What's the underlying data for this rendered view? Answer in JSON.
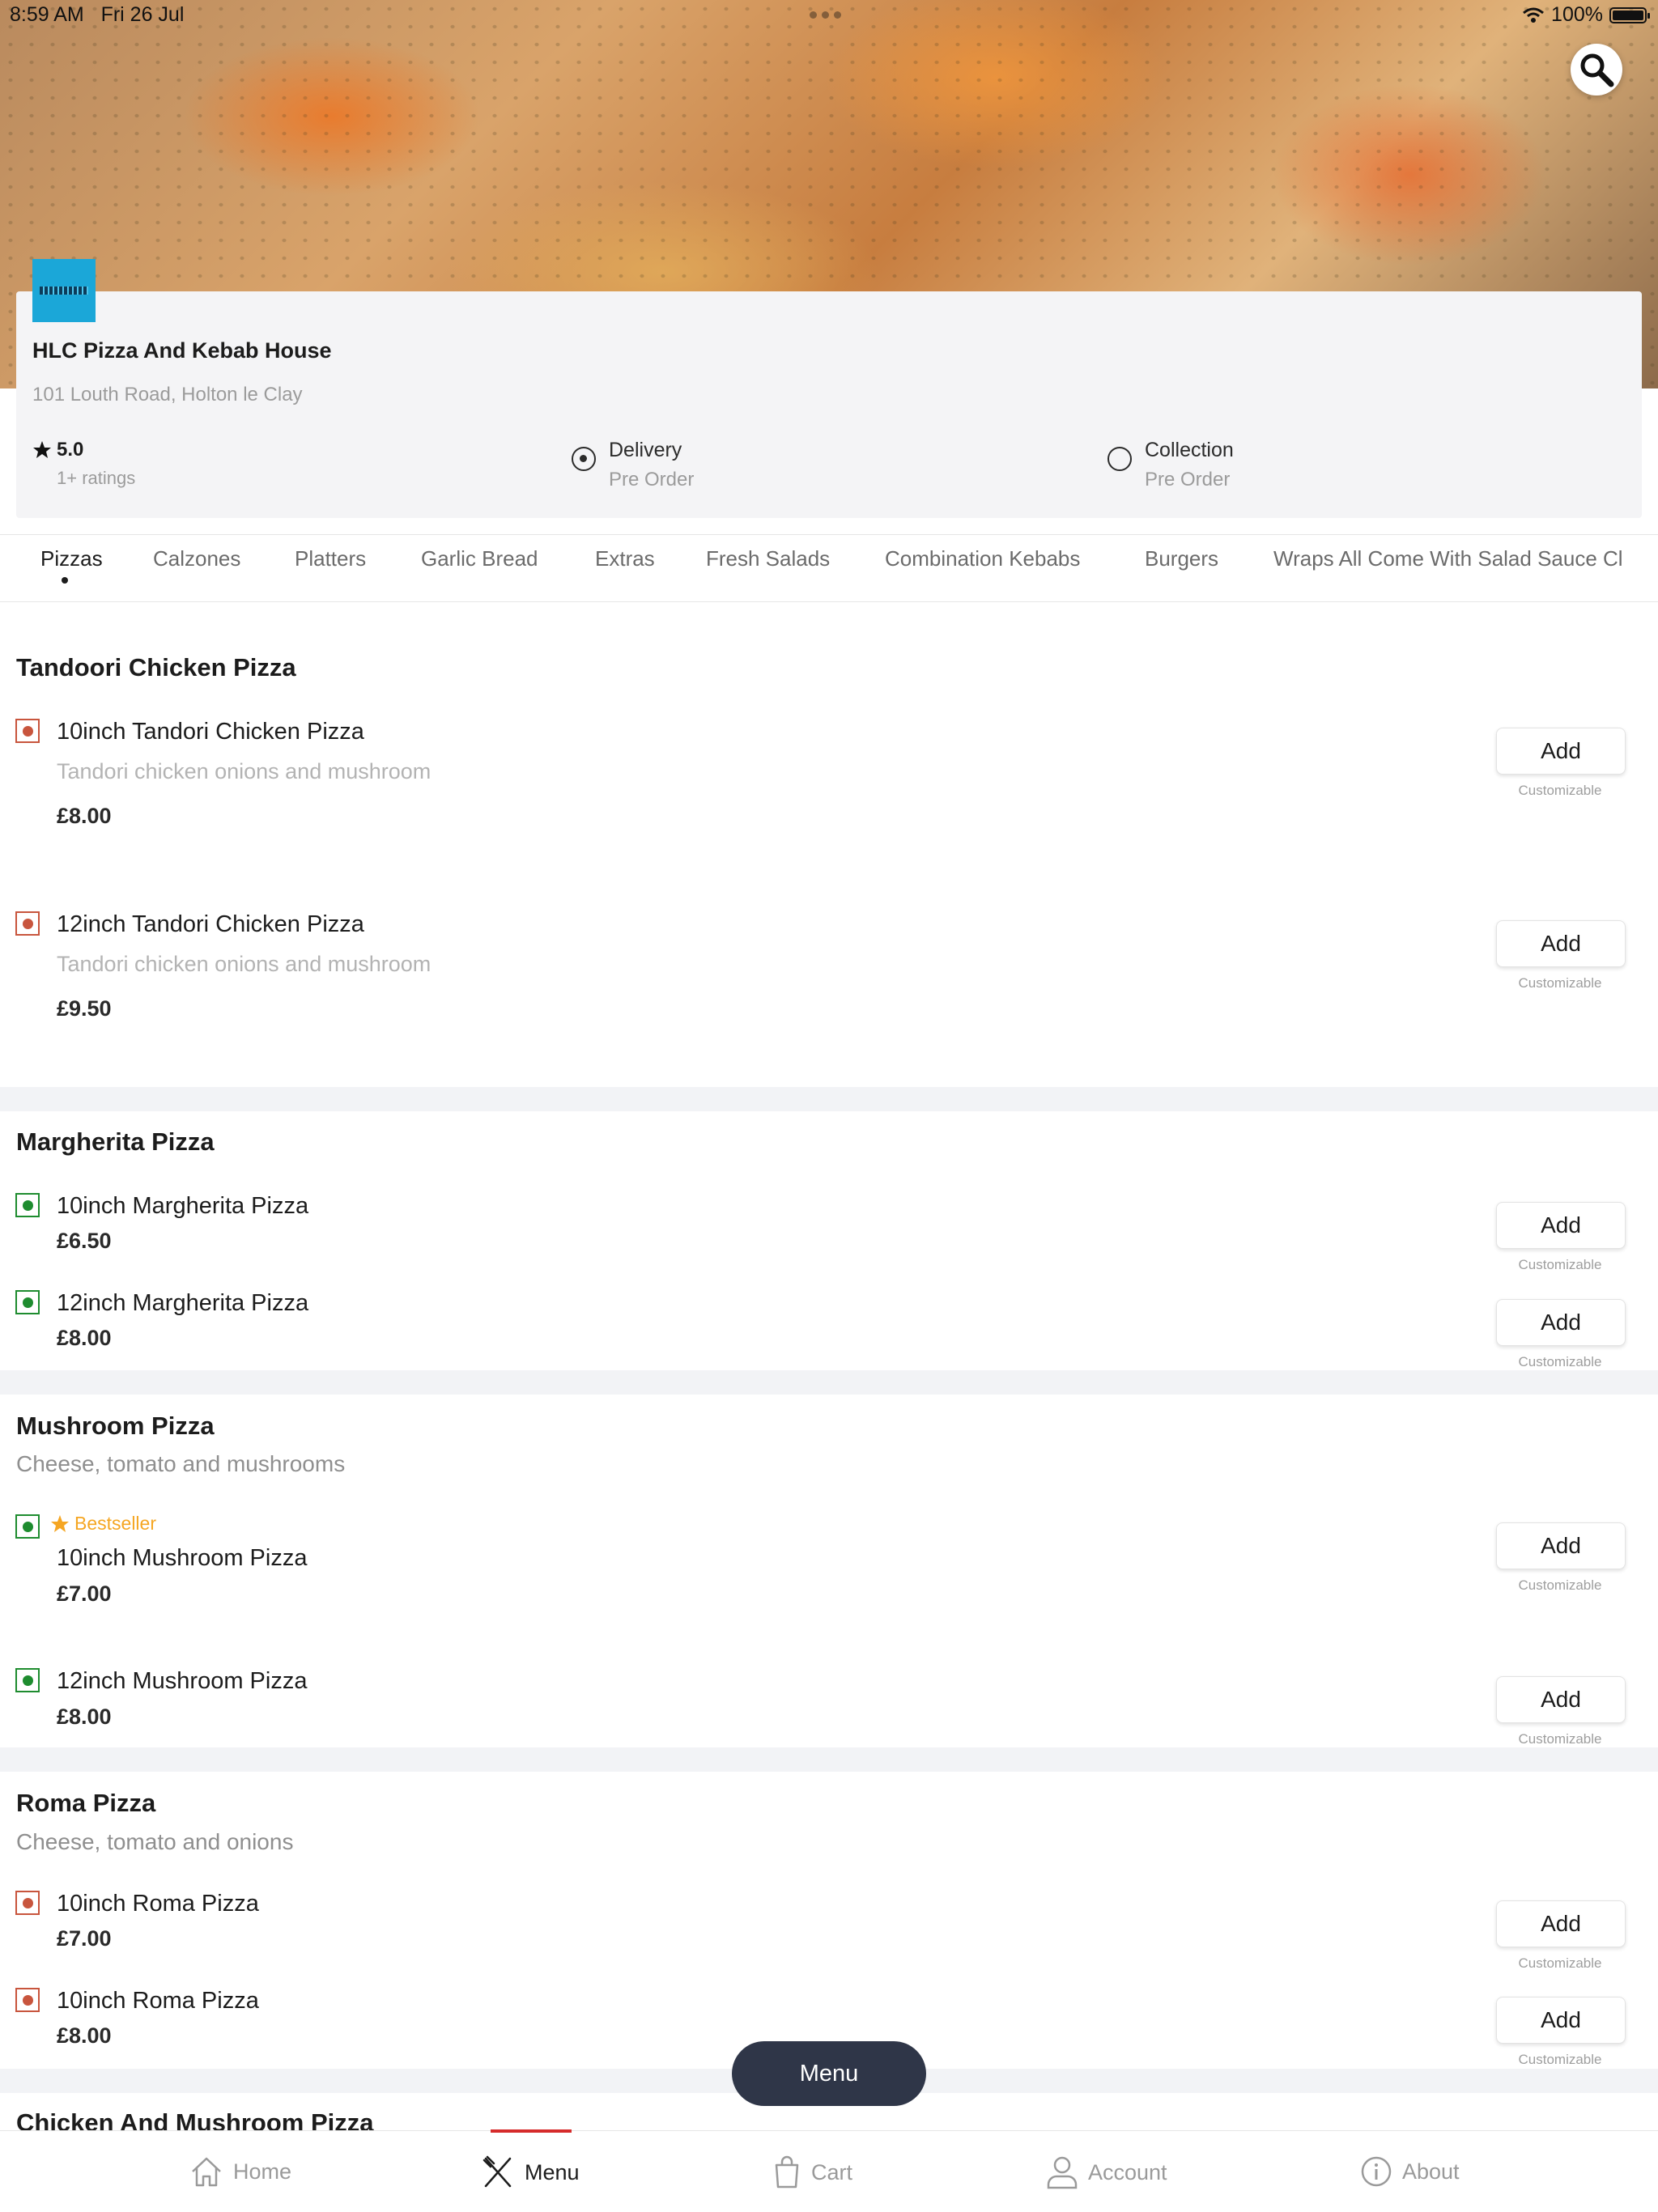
{
  "status_bar": {
    "time": "8:59 AM",
    "date": "Fri 26 Jul",
    "battery": "100%"
  },
  "icons": {
    "search": "search-icon",
    "star": "star-icon",
    "home": "home-icon",
    "menu": "fork-knife-icon",
    "cart": "cart-icon",
    "account": "account-icon",
    "about": "info-icon"
  },
  "restaurant": {
    "name": "HLC Pizza And Kebab House",
    "address": "101 Louth Road, Holton le Clay",
    "rating": "5.0",
    "ratings_count": "1+ ratings",
    "delivery": {
      "label": "Delivery",
      "sub": "Pre Order",
      "selected": true
    },
    "collection": {
      "label": "Collection",
      "sub": "Pre Order",
      "selected": false
    }
  },
  "tabs": [
    "Pizzas",
    "Calzones",
    "Platters",
    "Garlic Bread",
    "Extras",
    "Fresh Salads",
    "Combination Kebabs",
    "Burgers",
    "Wraps All Come With Salad Sauce Cl"
  ],
  "sections": [
    {
      "title": "Tandoori Chicken Pizza",
      "items": [
        {
          "name": "10inch Tandori Chicken Pizza",
          "desc": "Tandori chicken onions and mushroom",
          "price": "£8.00",
          "add": "Add",
          "custom": "Customizable"
        },
        {
          "name": "12inch Tandori Chicken Pizza",
          "desc": "Tandori chicken onions and mushroom",
          "price": "£9.50",
          "add": "Add",
          "custom": "Customizable"
        }
      ]
    },
    {
      "title": "Margherita Pizza",
      "items": [
        {
          "name": "10inch Margherita Pizza",
          "price": "£6.50",
          "add": "Add",
          "custom": "Customizable"
        },
        {
          "name": "12inch Margherita Pizza",
          "price": "£8.00",
          "add": "Add",
          "custom": "Customizable"
        }
      ]
    },
    {
      "title": "Mushroom Pizza",
      "desc": "Cheese, tomato and mushrooms",
      "items": [
        {
          "badge": "Bestseller",
          "name": "10inch Mushroom Pizza",
          "price": "£7.00",
          "add": "Add",
          "custom": "Customizable"
        },
        {
          "name": "12inch Mushroom Pizza",
          "price": "£8.00",
          "add": "Add",
          "custom": "Customizable"
        }
      ]
    },
    {
      "title": "Roma Pizza",
      "desc": "Cheese, tomato and onions",
      "items": [
        {
          "name": "10inch Roma Pizza",
          "price": "£7.00",
          "add": "Add",
          "custom": "Customizable"
        },
        {
          "name": "10inch Roma Pizza",
          "price": "£8.00",
          "add": "Add",
          "custom": "Customizable"
        }
      ]
    },
    {
      "title": "Chicken And Mushroom Pizza"
    }
  ],
  "float_menu": "Menu",
  "bottom_nav": [
    "Home",
    "Menu",
    "Cart",
    "Account",
    "About"
  ]
}
